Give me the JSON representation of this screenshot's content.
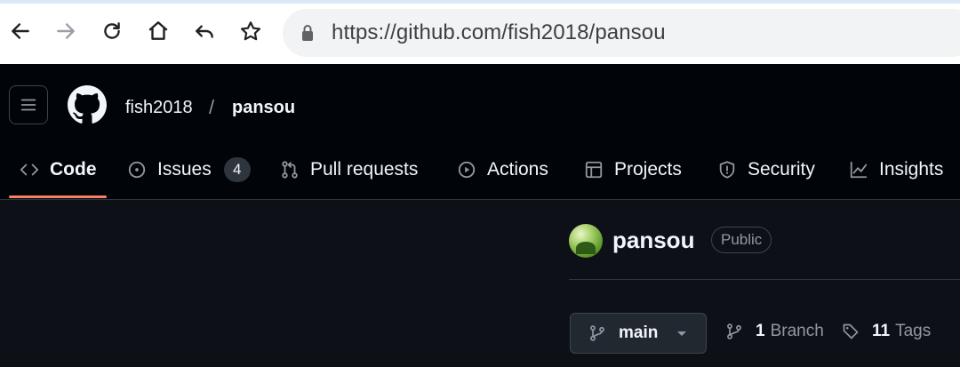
{
  "browser": {
    "url_scheme": "https://",
    "url_host": "github.com",
    "url_path": "/fish2018/pansou"
  },
  "header": {
    "owner": "fish2018",
    "separator": "/",
    "repo": "pansou"
  },
  "tabs": [
    {
      "label": "Code",
      "icon": "code-icon",
      "active": true
    },
    {
      "label": "Issues",
      "icon": "issue-opened-icon",
      "count": "4"
    },
    {
      "label": "Pull requests",
      "icon": "git-pull-request-icon"
    },
    {
      "label": "Actions",
      "icon": "play-icon"
    },
    {
      "label": "Projects",
      "icon": "table-icon"
    },
    {
      "label": "Security",
      "icon": "shield-icon"
    },
    {
      "label": "Insights",
      "icon": "graph-icon"
    }
  ],
  "repo": {
    "name": "pansou",
    "visibility": "Public",
    "branch": "main",
    "branch_count": "1",
    "branch_label": "Branch",
    "tag_count": "11",
    "tag_label": "Tags"
  },
  "colors": {
    "bg": "#0d1117",
    "header_bg": "#010409",
    "active_tab_underline": "#f78166",
    "text": "#f0f6fc",
    "muted": "#9198a1"
  }
}
